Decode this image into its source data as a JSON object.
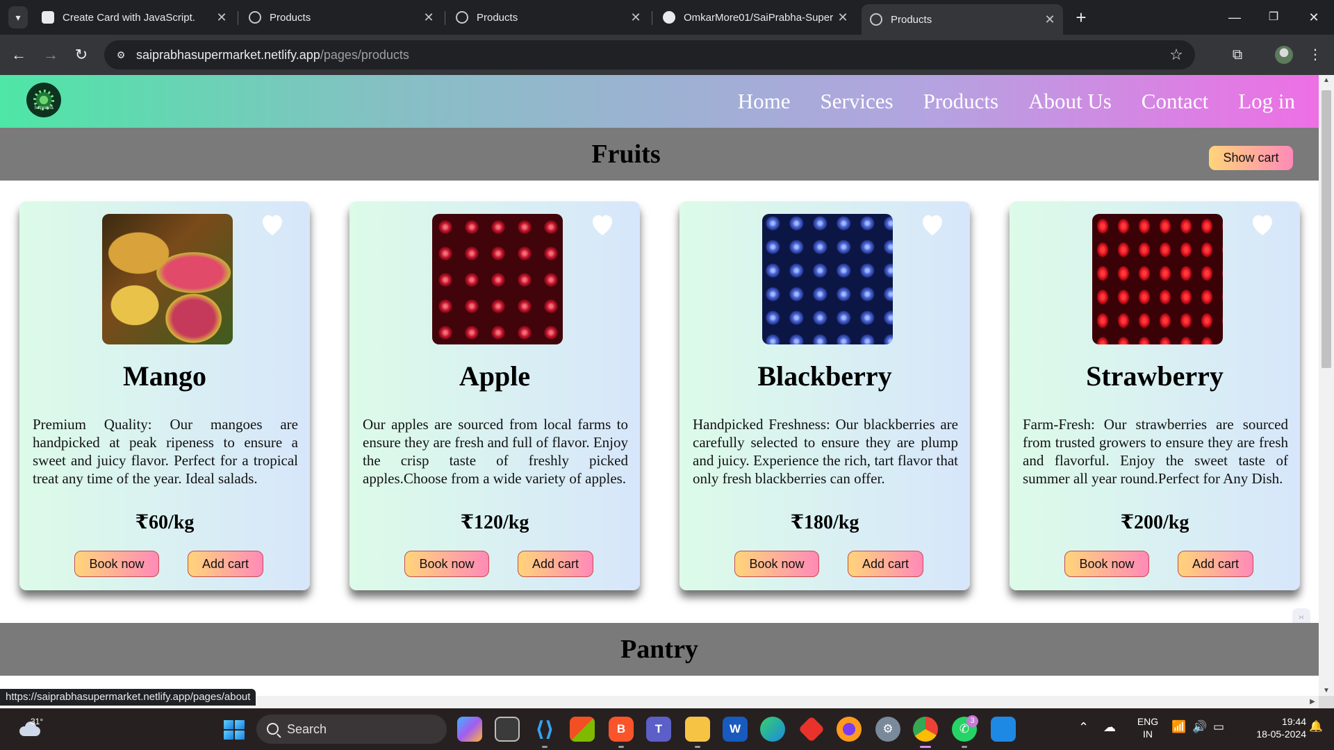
{
  "browser": {
    "tabs": [
      {
        "title": "Create Card with JavaScript.",
        "favicon": "openai-icon",
        "active": false
      },
      {
        "title": "Products",
        "favicon": "globe-icon",
        "active": false
      },
      {
        "title": "Products",
        "favicon": "globe-icon",
        "active": false
      },
      {
        "title": "OmkarMore01/SaiPrabha-Super",
        "favicon": "github-icon",
        "active": false
      },
      {
        "title": "Products",
        "favicon": "globe-icon",
        "active": true
      }
    ],
    "url_host": "saiprabhasupermarket.netlify.app",
    "url_path": "/pages/products",
    "status_url": "https://saiprabhasupermarket.netlify.app/pages/about"
  },
  "site": {
    "logo_text": "Saiprabha",
    "nav": [
      "Home",
      "Services",
      "Products",
      "About Us",
      "Contact",
      "Log in"
    ],
    "section_fruits": "Fruits",
    "show_cart": "Show cart",
    "section_pantry": "Pantry"
  },
  "products": [
    {
      "name": "Mango",
      "description": "Premium Quality: Our mangoes are handpicked at peak ripeness to ensure a sweet and juicy flavor. Perfect for a tropical treat any time of the year. Ideal salads.",
      "price": "₹60/kg",
      "book": "Book now",
      "add": "Add cart",
      "image": "mango"
    },
    {
      "name": "Apple",
      "description": "Our apples are sourced from local farms to ensure they are fresh and full of flavor. Enjoy the crisp taste of freshly picked apples.Choose from a wide variety of apples.",
      "price": "₹120/kg",
      "book": "Book now",
      "add": "Add cart",
      "image": "apple"
    },
    {
      "name": "Blackberry",
      "description": "Handpicked Freshness: Our blackberries are carefully selected to ensure they are plump and juicy. Experience the rich, tart flavor that only fresh blackberries can offer.",
      "price": "₹180/kg",
      "book": "Book now",
      "add": "Add cart",
      "image": "blackberry"
    },
    {
      "name": "Strawberry",
      "description": "Farm-Fresh: Our strawberries are sourced from trusted growers to ensure they are fresh and flavorful. Enjoy the sweet taste of summer all year round.Perfect for Any Dish.",
      "price": "₹200/kg",
      "book": "Book now",
      "add": "Add cart",
      "image": "strawberry"
    }
  ],
  "taskbar": {
    "weather_temp": "31°",
    "search_label": "Search",
    "lang_1": "ENG",
    "lang_2": "IN",
    "time": "19:44",
    "date": "18-05-2024",
    "whatsapp_badge": "3"
  },
  "colors": {
    "header_gradient_start": "#4ee6a6",
    "header_gradient_end": "#ee6fe5",
    "section_bar": "#7a7a7a",
    "button_gradient_start": "#ffd47a",
    "button_gradient_end": "#ff8ab8"
  }
}
